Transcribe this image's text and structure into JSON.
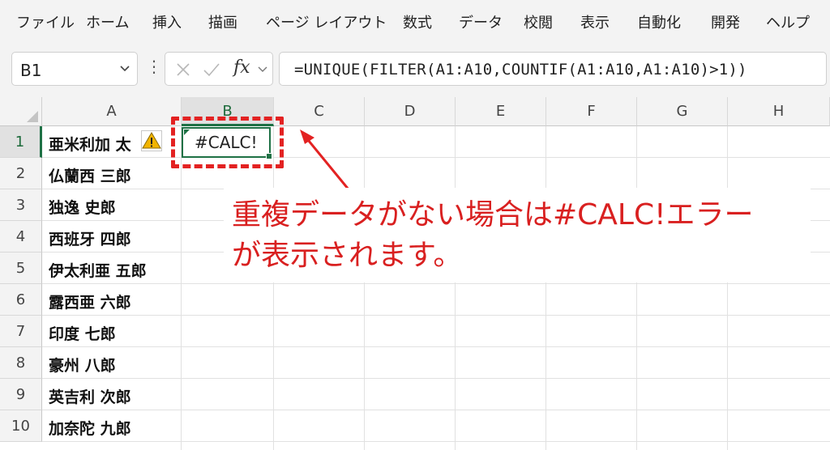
{
  "ribbon": {
    "tabs": [
      "ファイル",
      "ホーム",
      "挿入",
      "描画",
      "ページ レイアウト",
      "数式",
      "データ",
      "校閲",
      "表示",
      "自動化",
      "開発",
      "ヘルプ"
    ]
  },
  "formula_bar": {
    "name_box": "B1",
    "fx_label": "fx",
    "formula": "=UNIQUE(FILTER(A1:A10,COUNTIF(A1:A10,A1:A10)>1))"
  },
  "sheet": {
    "columns": [
      "A",
      "B",
      "C",
      "D",
      "E",
      "F",
      "G",
      "H"
    ],
    "rows": [
      "1",
      "2",
      "3",
      "4",
      "5",
      "6",
      "7",
      "8",
      "9",
      "10"
    ],
    "column_a_values": [
      "亜米利加 太",
      "仏蘭西 三郎",
      "独逸 史郎",
      "西班牙 四郎",
      "伊太利亜 五郎",
      "露西亜 六郎",
      "印度 七郎",
      "豪州 八郎",
      "英吉利 次郎",
      "加奈陀 九郎"
    ],
    "b1_value": "#CALC!"
  },
  "annotation": {
    "line1": "重複データがない場合は#CALC!エラー",
    "line2": "が表示されます。",
    "color": "#d92020"
  },
  "colors": {
    "accent": "#1e7145",
    "highlight_red": "#e32222"
  }
}
